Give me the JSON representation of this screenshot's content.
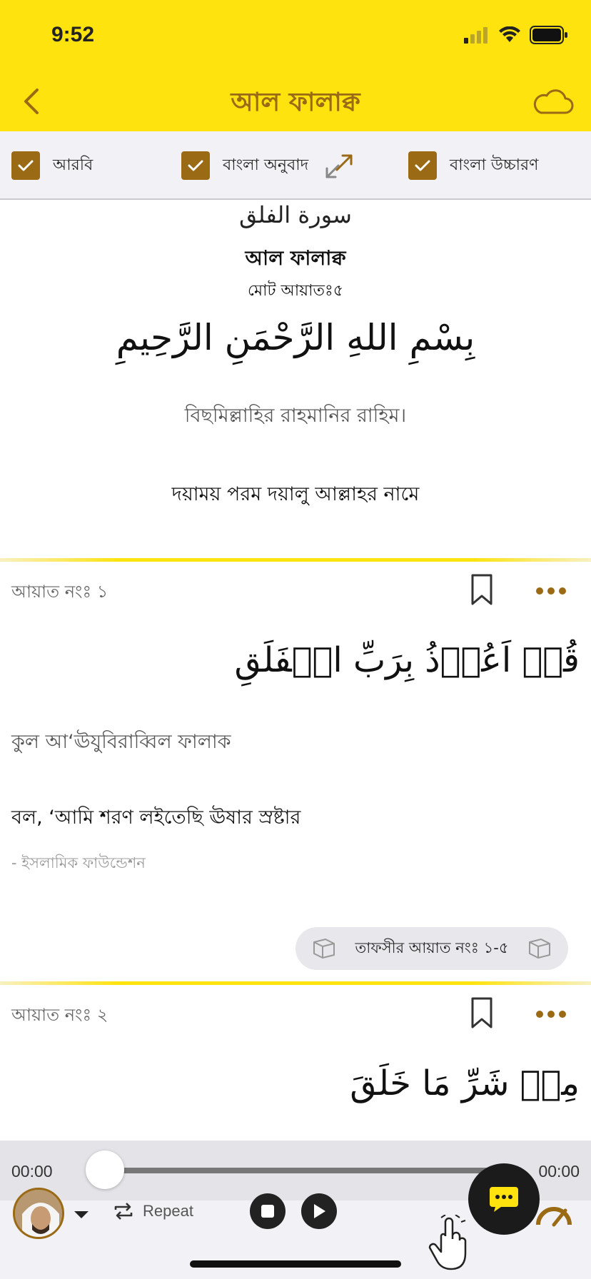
{
  "status_bar": {
    "time": "9:52"
  },
  "nav": {
    "title": "আল ফালাক্ব"
  },
  "toggles": [
    {
      "label": "আরবি",
      "checked": true
    },
    {
      "label": "বাংলা অনুবাদ",
      "checked": true
    },
    {
      "label": "বাংলা উচ্চারণ",
      "checked": true
    }
  ],
  "header": {
    "surah_arabic": "سورة الفلق",
    "surah_bangla": "আল ফালাক্ব",
    "total_ayat": "মোট আয়াতঃ৫",
    "bismillah_arabic": "بِسْمِ اللهِ الرَّحْمَنِ الرَّحِيمِ",
    "bismillah_transliteration": "বিছমিল্লাহির রাহমানির রাহিম।",
    "bismillah_meaning": "দয়াময় পরম দয়ালু আল্লাহর নামে"
  },
  "ayahs": [
    {
      "number": "আয়াত নংঃ ১",
      "arabic": "قُلۡ اَعُوۡذُ بِرَبِّ الۡفَلَقِ",
      "transliteration": "কুল আ‘ঊযুবিরাব্বিল ফালাক",
      "meaning": "বল, ‘আমি শরণ লইতেছি ঊষার স্রষ্টার",
      "source": "- ইসলামিক ফাউন্ডেশন",
      "tafsir_label": "তাফসীর আয়াত নংঃ ১-৫"
    },
    {
      "number": "আয়াত নংঃ ২",
      "arabic": "مِنۡ شَرِّ مَا خَلَقَ"
    }
  ],
  "player": {
    "time_elapsed": "00:00",
    "time_total": "00:00",
    "progress": 0,
    "repeat_label": "Repeat"
  },
  "colors": {
    "accent_yellow": "#FEE30E",
    "accent_brown": "#9A6A15"
  }
}
